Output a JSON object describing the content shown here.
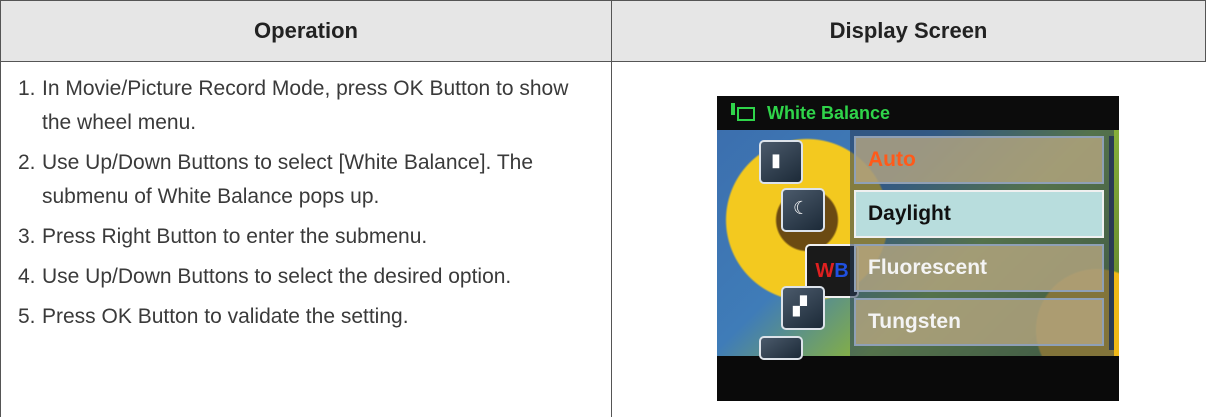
{
  "table": {
    "header_operation": "Operation",
    "header_display": "Display Screen"
  },
  "steps": [
    {
      "num": "1.",
      "text": "In Movie/Picture Record Mode, press OK Button to show the wheel menu."
    },
    {
      "num": "2.",
      "text": "Use Up/Down Buttons to select [White Balance]. The submenu of White Balance pops up."
    },
    {
      "num": "3.",
      "text": "Press Right Button to enter the submenu."
    },
    {
      "num": "4.",
      "text": "Use Up/Down Buttons to select the desired option."
    },
    {
      "num": "5.",
      "text": "Press OK Button to validate the setting."
    }
  ],
  "screen": {
    "title": "White Balance",
    "wb_icon_w": "W",
    "wb_icon_b": "B",
    "options": [
      "Auto",
      "Daylight",
      "Fluorescent",
      "Tungsten"
    ],
    "current_option": "Auto",
    "highlighted_option": "Daylight",
    "colors": {
      "title_green": "#2fd44a",
      "auto_orange": "#ff5a1a",
      "highlight": "#b8dddd"
    }
  }
}
